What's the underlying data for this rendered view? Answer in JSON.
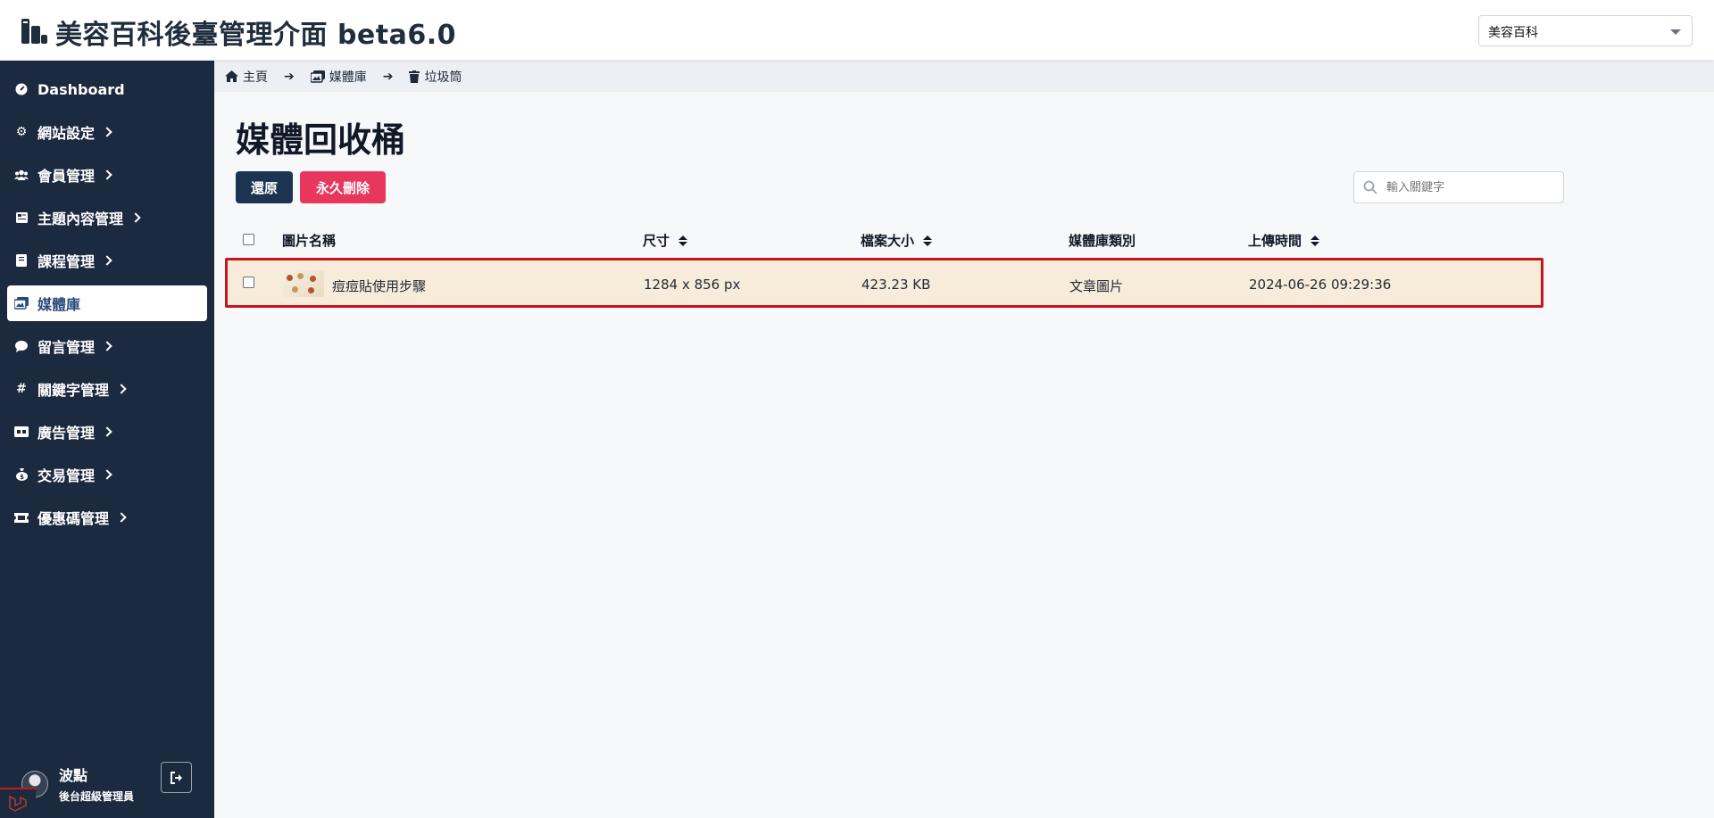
{
  "header": {
    "title": "美容百科後臺管理介面 beta6.0",
    "site_select_value": "美容百科"
  },
  "sidebar": {
    "items": [
      {
        "label": "Dashboard",
        "icon": "dashboard-icon"
      },
      {
        "label": "網站設定",
        "icon": "gear-icon"
      },
      {
        "label": "會員管理",
        "icon": "users-icon"
      },
      {
        "label": "主題內容管理",
        "icon": "newspaper-icon"
      },
      {
        "label": "課程管理",
        "icon": "book-icon"
      },
      {
        "label": "媒體庫",
        "icon": "images-icon",
        "active": true
      },
      {
        "label": "留言管理",
        "icon": "comment-icon"
      },
      {
        "label": "關鍵字管理",
        "icon": "hashtag-icon"
      },
      {
        "label": "廣告管理",
        "icon": "ad-icon"
      },
      {
        "label": "交易管理",
        "icon": "money-bag-icon"
      },
      {
        "label": "優惠碼管理",
        "icon": "ticket-icon"
      }
    ],
    "user": {
      "name": "波點",
      "role": "後台超級管理員"
    }
  },
  "breadcrumb": {
    "home": "主頁",
    "library": "媒體庫",
    "trash": "垃圾筒"
  },
  "main": {
    "title": "媒體回收桶",
    "restore_label": "還原",
    "delete_label": "永久刪除",
    "search_placeholder": "輸入關鍵字",
    "columns": {
      "name": "圖片名稱",
      "size": "尺寸",
      "filesize": "檔案大小",
      "category": "媒體庫類別",
      "uploaded": "上傳時間"
    },
    "rows": [
      {
        "name": "痘痘貼使用步驟",
        "size": "1284 x 856 px",
        "filesize": "423.23 KB",
        "category": "文章圖片",
        "uploaded": "2024-06-26 09:29:36"
      }
    ]
  },
  "colors": {
    "sidebar_bg": "#1c2a40",
    "restore_btn": "#1c3452",
    "delete_btn": "#e8365d",
    "highlight_border": "#c8141c",
    "row_bg": "#f7ecd9"
  }
}
